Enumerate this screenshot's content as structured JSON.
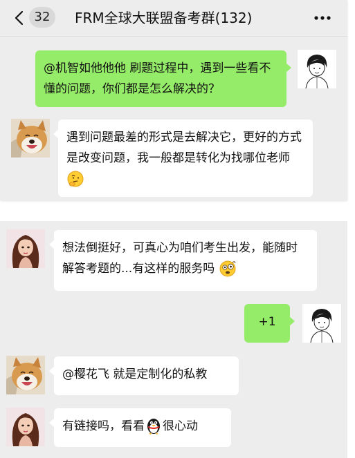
{
  "header": {
    "unread_count": "32",
    "title": "FRM全球大联盟备考群(132)"
  },
  "messages": [
    {
      "side": "right",
      "avatar": "cartoon-boy-avatar",
      "text": "@机智如他他他 刷题过程中，遇到一些看不懂的问题，你们都是怎么解决的？"
    },
    {
      "side": "left",
      "avatar": "shiba-dog-avatar",
      "text": "遇到问题最差的形式是去解决它，更好的方式是改变问题，我一般都是转化为找哪位老师",
      "emoji": "thinking-emoji"
    },
    {
      "side": "left",
      "avatar": "girl-portrait-avatar",
      "text": "想法倒挺好，可真心为咱们考生出发，能随时解答考题的...有这样的服务吗",
      "emoji": "confused-emoji"
    },
    {
      "side": "right",
      "avatar": "cartoon-boy-avatar",
      "text": "+1"
    },
    {
      "side": "left",
      "avatar": "shiba-dog-avatar",
      "text": "@樱花飞 就是定制化的私教"
    },
    {
      "side": "left",
      "avatar": "girl-portrait-avatar",
      "text_before": "有链接吗，看看",
      "emoji": "penguin-emoji",
      "text_after": "很心动"
    }
  ],
  "colors": {
    "chat_background": "#ededed",
    "self_bubble": "#95ec69",
    "other_bubble": "#ffffff"
  }
}
